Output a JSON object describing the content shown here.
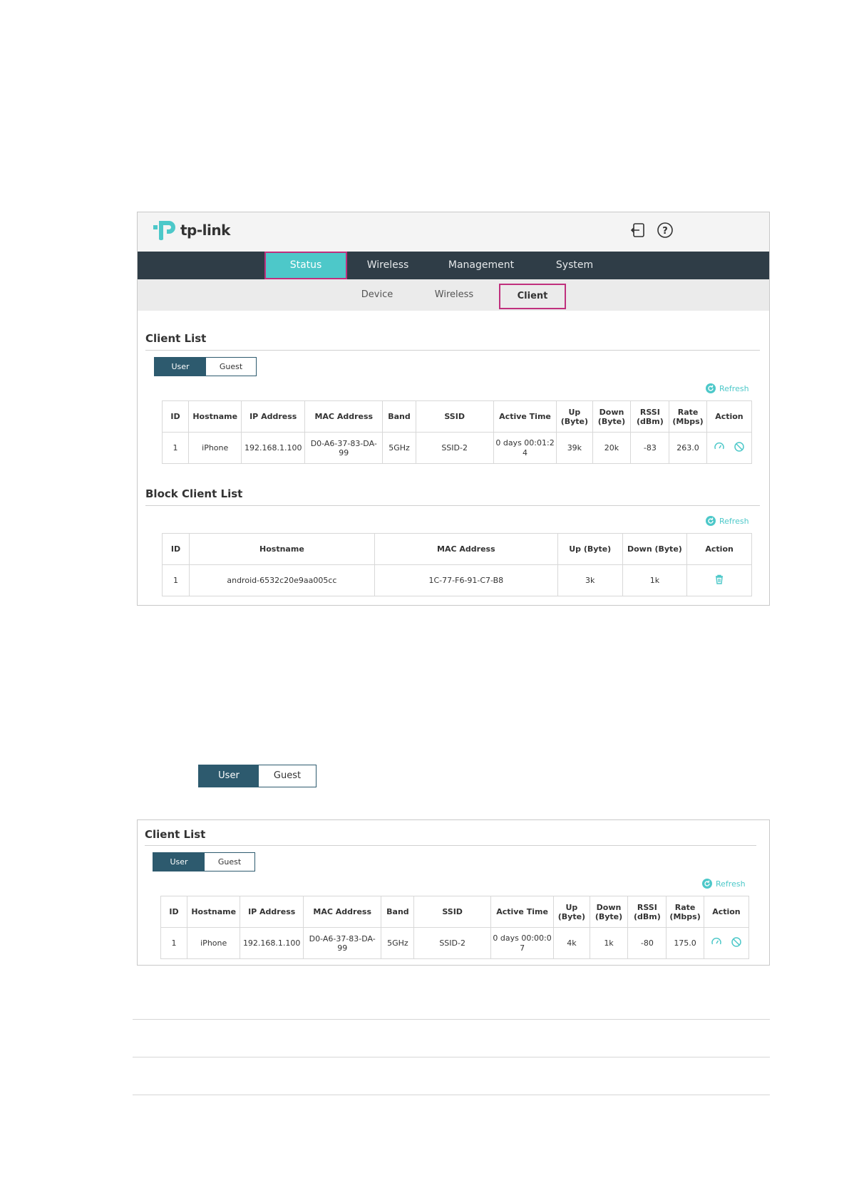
{
  "brand": {
    "name": "tp-link"
  },
  "header_icons": [
    "logout-icon",
    "help-icon"
  ],
  "main_nav": {
    "items": [
      "Status",
      "Wireless",
      "Management",
      "System"
    ],
    "active": "Status"
  },
  "sub_nav": {
    "items": [
      "Device",
      "Wireless",
      "Client"
    ],
    "active": "Client"
  },
  "client_list": {
    "title": "Client List",
    "tabs": {
      "user": "User",
      "guest": "Guest",
      "active": "User"
    },
    "refresh_label": "Refresh",
    "headers": [
      "ID",
      "Hostname",
      "IP Address",
      "MAC Address",
      "Band",
      "SSID",
      "Active Time",
      "Up (Byte)",
      "Down (Byte)",
      "RSSI (dBm)",
      "Rate (Mbps)",
      "Action"
    ],
    "rows": [
      {
        "id": "1",
        "hostname": "iPhone",
        "ip": "192.168.1.100",
        "mac": "D0-A6-37-83-DA-99",
        "band": "5GHz",
        "ssid": "SSID-2",
        "active_time": "0 days 00:01:24",
        "up": "39k",
        "down": "20k",
        "rssi": "-83",
        "rate": "263.0"
      }
    ]
  },
  "block_client_list": {
    "title": "Block Client List",
    "refresh_label": "Refresh",
    "headers": [
      "ID",
      "Hostname",
      "MAC Address",
      "Up (Byte)",
      "Down (Byte)",
      "Action"
    ],
    "rows": [
      {
        "id": "1",
        "hostname": "android-6532c20e9aa005cc",
        "mac": "1C-77-F6-91-C7-B8",
        "up": "3k",
        "down": "1k"
      }
    ]
  },
  "standalone_tabs": {
    "user": "User",
    "guest": "Guest"
  },
  "client_list_2": {
    "title": "Client List",
    "tabs": {
      "user": "User",
      "guest": "Guest"
    },
    "refresh_label": "Refresh",
    "headers": [
      "ID",
      "Hostname",
      "IP Address",
      "MAC Address",
      "Band",
      "SSID",
      "Active Time",
      "Up (Byte)",
      "Down (Byte)",
      "RSSI (dBm)",
      "Rate (Mbps)",
      "Action"
    ],
    "rows": [
      {
        "id": "1",
        "hostname": "iPhone",
        "ip": "192.168.1.100",
        "mac": "D0-A6-37-83-DA-99",
        "band": "5GHz",
        "ssid": "SSID-2",
        "active_time": "0 days 00:00:07",
        "up": "4k",
        "down": "1k",
        "rssi": "-80",
        "rate": "175.0"
      }
    ]
  },
  "colors": {
    "nav_bg": "#2f3d47",
    "accent": "#4dc8c9",
    "highlight": "#c0307d",
    "tab_active": "#2d5a6e"
  }
}
